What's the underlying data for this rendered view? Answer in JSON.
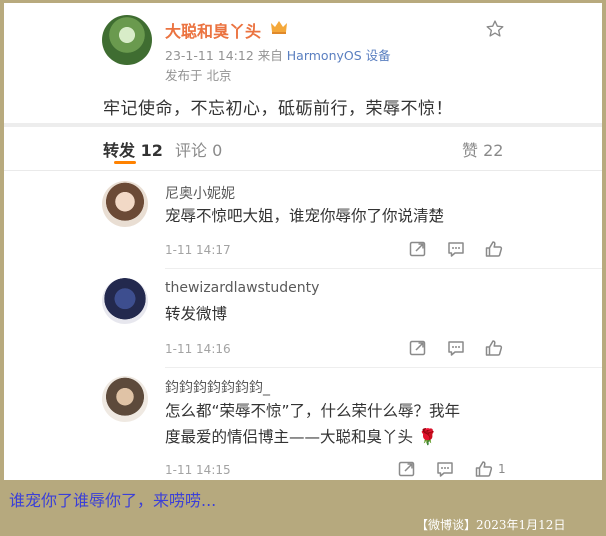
{
  "post": {
    "author": "大聪和臭丫头",
    "author_badge_icon": "crown-icon",
    "date_time": "23-1-11 14:12",
    "source_prefix": "来自",
    "source_device": "HarmonyOS 设备",
    "location": "发布于 北京",
    "text": "牢记使命，不忘初心，砥砺前行，荣辱不惊！"
  },
  "tabs": {
    "repost": "转发 12",
    "comment": "评论 0",
    "like": "赞 22"
  },
  "comments": [
    {
      "name": "尼奥小妮妮",
      "text": "宠辱不惊吧大姐，谁宠你辱你了你说清楚",
      "time": "1-11 14:17"
    },
    {
      "name": "thewizardlawstudenty",
      "text": "转发微博",
      "time": "1-11 14:16"
    },
    {
      "name": "鈞鈞鈞鈞鈞鈞鈞_",
      "text_line1": "怎么都“荣辱不惊”了，什么荣什么辱？我年",
      "text_line2": "度最爱的情侣博主——大聪和臭丫头",
      "emoji": "🌹",
      "time": "1-11 14:15",
      "like_count": "1"
    }
  ],
  "banner": {
    "caption": "谁宠你了谁辱你了，来唠唠...",
    "credit": "【微博谈】2023年1月12日"
  },
  "colors": {
    "accent": "#ff8200",
    "username": "#eb7340",
    "banner_text": "#3b3fd8"
  }
}
